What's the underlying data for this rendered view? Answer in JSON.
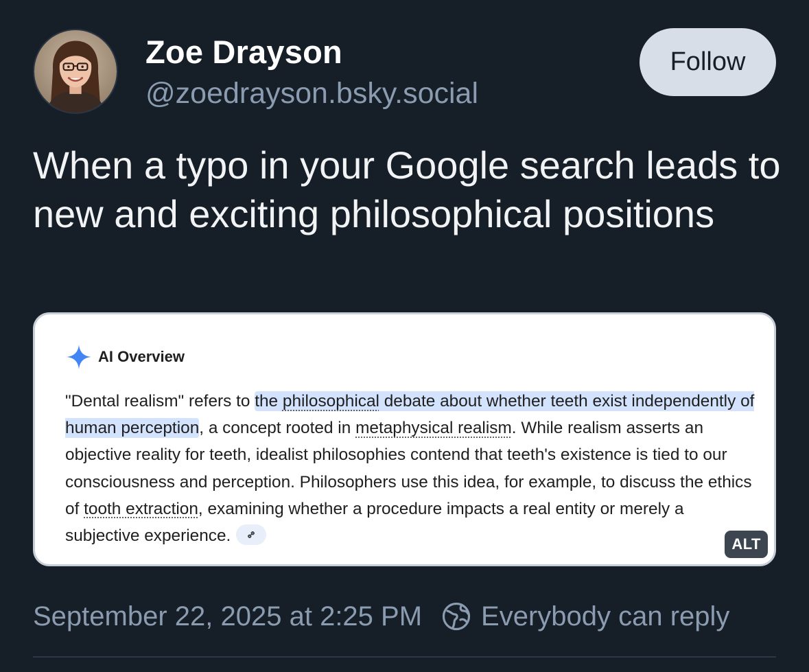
{
  "post": {
    "author": {
      "display_name": "Zoe Drayson",
      "handle": "@zoedrayson.bsky.social"
    },
    "follow_label": "Follow",
    "text": "When a typo in your Google search leads to new and exciting philosophical positions",
    "timestamp": "September 22, 2025 at 2:25 PM",
    "reply_setting": "Everybody can reply"
  },
  "image": {
    "alt_badge": "ALT",
    "ai_overview": {
      "title": "AI Overview",
      "segments": [
        "\"Dental realism\" refers to ",
        "the ",
        "philosophical",
        " debate about whether teeth exist independently of human perception",
        ", a concept rooted in ",
        "metaphysical realism",
        ". While realism asserts an objective reality for teeth, idealist philosophies contend that teeth's existence is tied to our consciousness and perception. Philosophers use this idea, for example, to discuss the ethics of ",
        "tooth extraction",
        ", examining whether a procedure impacts a real entity or merely a subjective experience."
      ]
    }
  },
  "colors": {
    "background": "#161e27",
    "follow_button": "#d8dee8",
    "muted_text": "#8b9bb0",
    "highlight": "#d3e3fd",
    "sparkle": "#4285f4"
  },
  "icons": {
    "sparkle": "sparkle-icon",
    "link": "link-icon",
    "globe": "globe-icon"
  }
}
